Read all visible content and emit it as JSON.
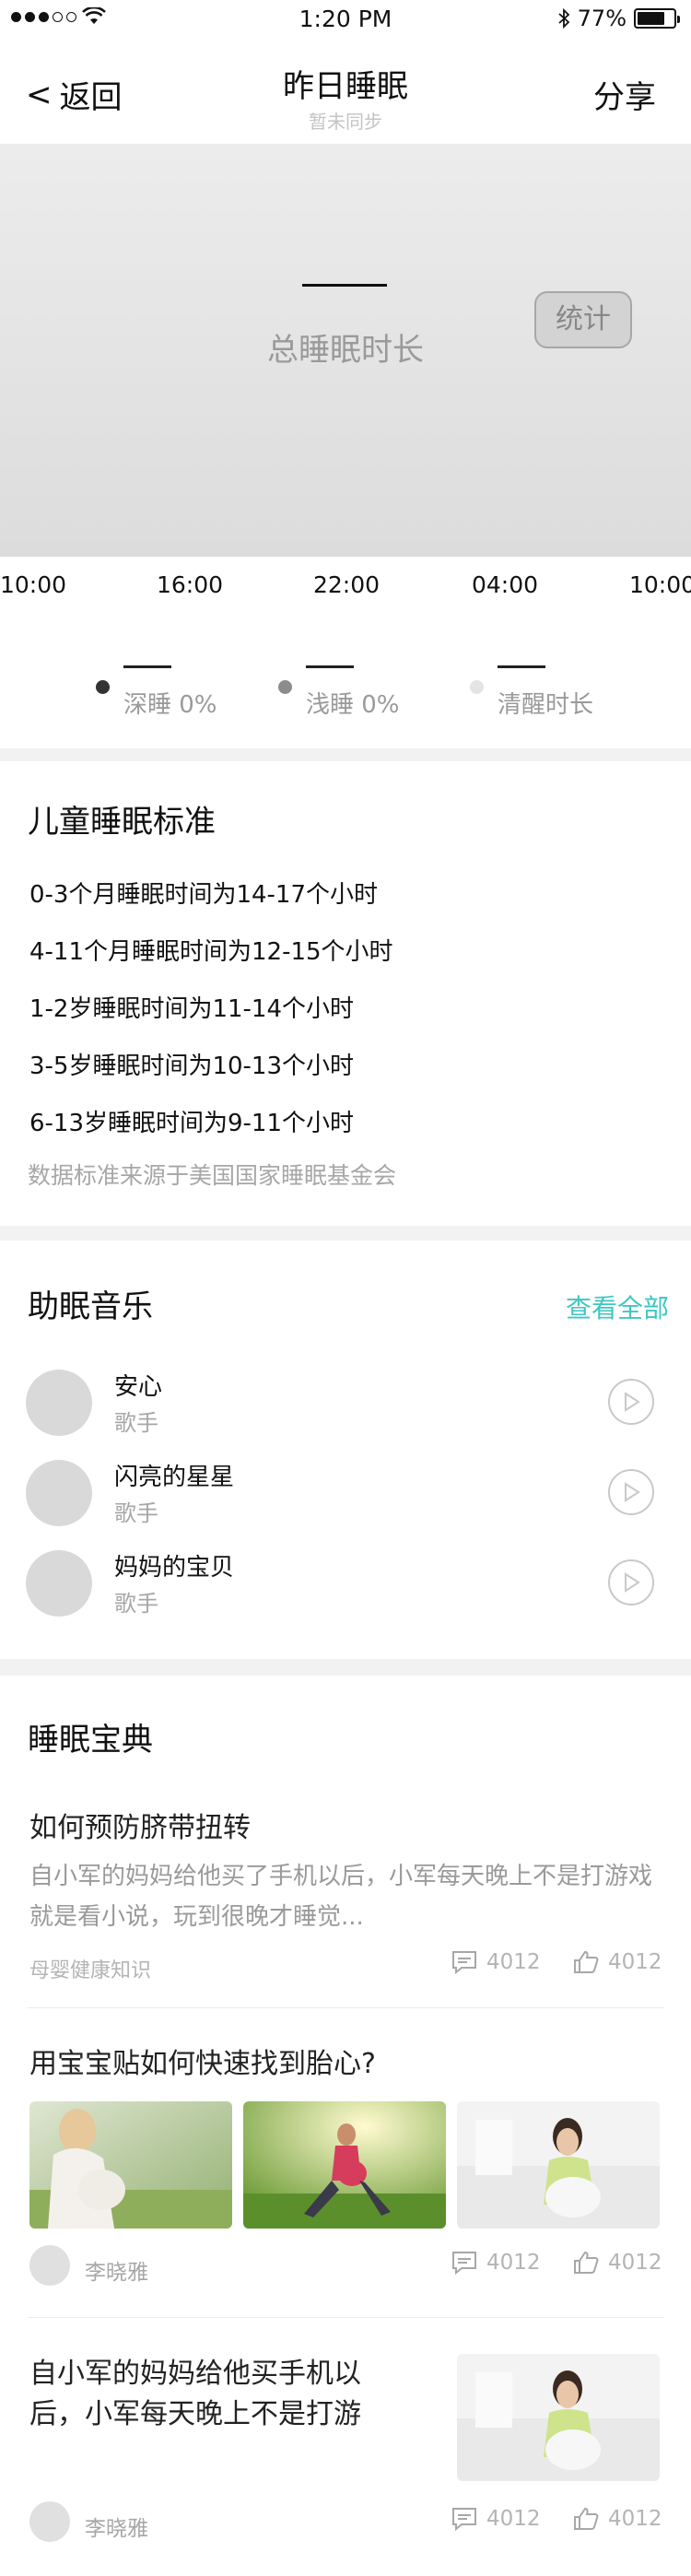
{
  "status_bar": {
    "time": "1:20 PM",
    "battery": "77%",
    "battery_level": 0.77
  },
  "nav": {
    "back_label": "返回",
    "back_arrow": "<",
    "title": "昨日睡眠",
    "subtitle": "暂未同步",
    "share_label": "分享"
  },
  "hero": {
    "total_label": "总睡眠时长",
    "stat_button": "统计"
  },
  "timeline": {
    "times": [
      "10:00",
      "16:00",
      "22:00",
      "04:00",
      "10:00"
    ]
  },
  "legend": [
    {
      "label": "深睡 0%",
      "color": "#333333"
    },
    {
      "label": "浅睡 0%",
      "color": "#8c8c8c"
    },
    {
      "label": "清醒时长",
      "color": "#e4e4e4"
    }
  ],
  "standards": {
    "title": "儿童睡眠标准",
    "lines": [
      "0-3个月睡眠时间为14-17个小时",
      "4-11个月睡眠时间为12-15个小时",
      "1-2岁睡眠时间为11-14个小时",
      "3-5岁睡眠时间为10-13个小时",
      "6-13岁睡眠时间为9-11个小时"
    ],
    "source": "数据标准来源于美国国家睡眠基金会"
  },
  "music": {
    "title": "助眠音乐",
    "see_all": "查看全部",
    "songs": [
      {
        "name": "安心",
        "artist": "歌手"
      },
      {
        "name": "闪亮的星星",
        "artist": "歌手"
      },
      {
        "name": "妈妈的宝贝",
        "artist": "歌手"
      }
    ]
  },
  "guide": {
    "title": "睡眠宝典",
    "articles": [
      {
        "title": "如何预防脐带扭转",
        "desc": "自小军的妈妈给他买了手机以后，小军每天晚上不是打游戏就是看小说，玩到很晚才睡觉...",
        "source": "母婴健康知识",
        "comments": "4012",
        "likes": "4012"
      },
      {
        "title": "用宝宝贴如何快速找到胎心?",
        "author": "李晓雅",
        "comments": "4012",
        "likes": "4012"
      },
      {
        "title": "自小军的妈妈给他买手机以后，小军每天晚上不是打游",
        "author": "李晓雅",
        "comments": "4012",
        "likes": "4012"
      }
    ]
  },
  "colors": {
    "accent": "#3fc7c0",
    "background": "#f2f2f2"
  }
}
